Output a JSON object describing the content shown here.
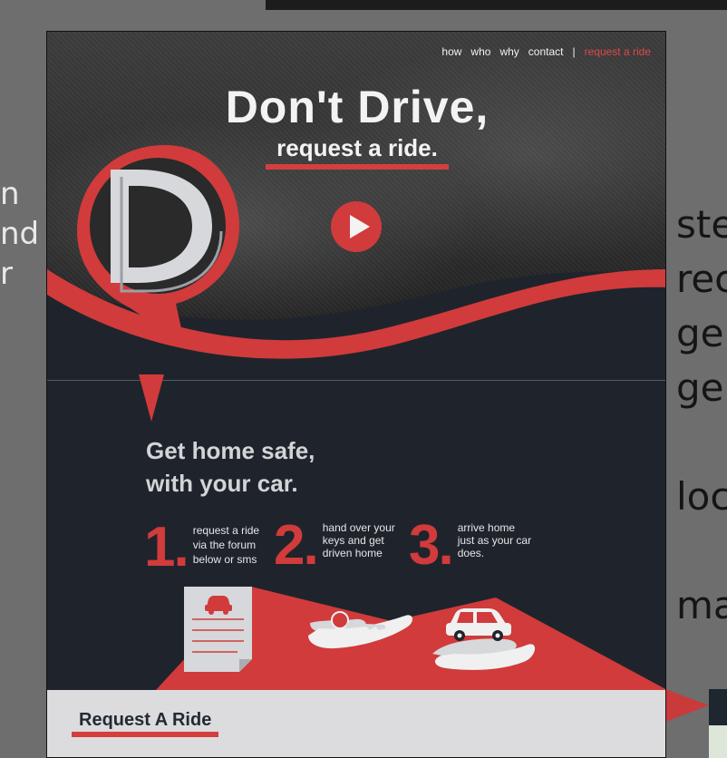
{
  "side_left_lines": [
    "n",
    "nd",
    "r"
  ],
  "side_right_lines": [
    "ste",
    "rec",
    "ge",
    "ge",
    "",
    "loc",
    "",
    "ma"
  ],
  "nav": {
    "how": "how",
    "who": "who",
    "why": "why",
    "contact": "contact",
    "separator": "|",
    "request": "request a ride"
  },
  "hero": {
    "headline": "Don't Drive,",
    "subline": "request a ride."
  },
  "section": {
    "title_line1": "Get home safe,",
    "title_line2": "with your car."
  },
  "steps": [
    {
      "num": "1.",
      "text": [
        "request a ride",
        "via the forum",
        "below or sms"
      ]
    },
    {
      "num": "2.",
      "text": [
        "hand over your",
        "keys and get",
        "driven home"
      ]
    },
    {
      "num": "3.",
      "text": [
        "arrive home",
        "just as your car",
        "does."
      ]
    }
  ],
  "request": {
    "title": "Request A Ride"
  },
  "colors": {
    "accent": "#d13b3b",
    "dark": "#1f242c",
    "light": "#dcdcde"
  },
  "icons": [
    "logo-d-icon",
    "play-icon",
    "form-icon",
    "car-icon",
    "key-hand-icon",
    "car-hand-icon"
  ]
}
